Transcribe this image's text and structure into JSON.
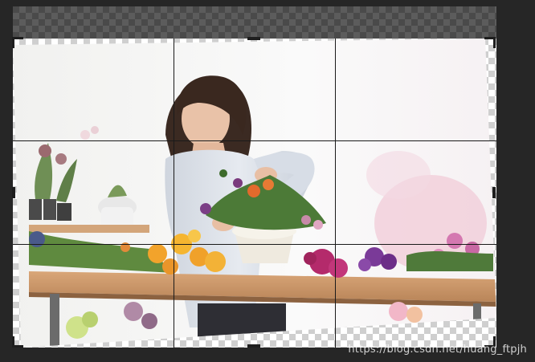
{
  "editor": {
    "mode": "crop",
    "tool": "crop-tool",
    "overlay": "rule-of-thirds",
    "colors": {
      "workspace": "#262626",
      "transparency_light": "#ffffff",
      "transparency_dark": "#cfcfcf",
      "grid_line": "#1a1a1a"
    }
  },
  "image": {
    "subject": "florist-arranging-flowers"
  },
  "watermark": {
    "text": "https://blog.csdn.net/huang_ftpjh"
  }
}
